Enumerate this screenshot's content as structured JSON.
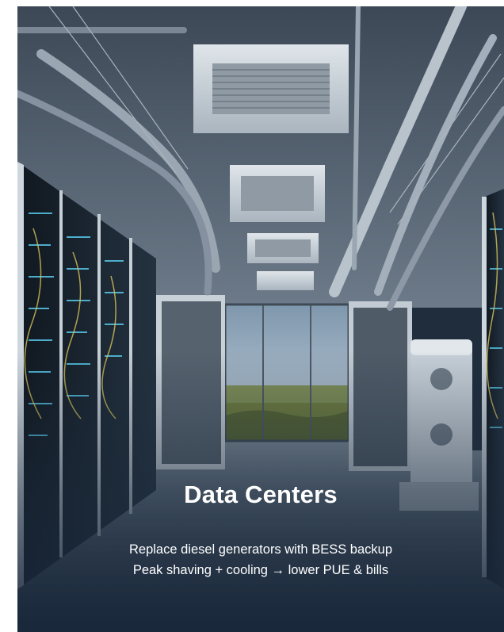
{
  "card": {
    "title": "Data Centers",
    "lines": [
      "Replace diesel generators with BESS backup",
      "Peak shaving + cooling → lower PUE & bills"
    ]
  },
  "image": {
    "subject": "server-room-photo",
    "colors": {
      "ceiling": "#4a5868",
      "rack": "#1c2733",
      "floor": "#3a4858",
      "sky": "#9fb6c9",
      "field": "#6f7d3f",
      "overlay": "#1b2a3c"
    }
  }
}
